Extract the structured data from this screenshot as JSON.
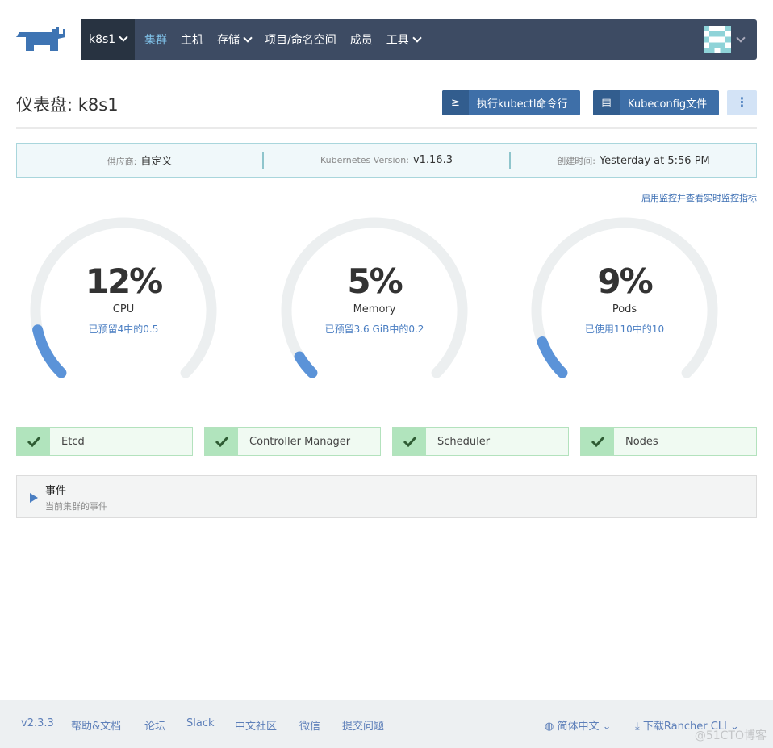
{
  "nav": {
    "cluster": "k8s1",
    "items": [
      {
        "label": "集群",
        "active": true
      },
      {
        "label": "主机"
      },
      {
        "label": "存储",
        "dropdown": true
      },
      {
        "label": "项目/命名空间"
      },
      {
        "label": "成员"
      },
      {
        "label": "工具",
        "dropdown": true
      }
    ]
  },
  "header": {
    "title": "仪表盘: k8s1",
    "kubectl_label": "执行kubectl命令行",
    "kubeconfig_label": "Kubeconfig文件"
  },
  "info": {
    "provider_key": "供应商:",
    "provider": "自定义",
    "version_key": "Kubernetes Version:",
    "version": "v1.16.3",
    "created_key": "创建时间:",
    "created": "Yesterday at 5:56 PM"
  },
  "monitor_link": "启用监控并查看实时监控指标",
  "gauges": [
    {
      "value": "12%",
      "percent": 12,
      "label": "CPU",
      "sub": "已预留4中的0.5"
    },
    {
      "value": "5%",
      "percent": 5,
      "label": "Memory",
      "sub": "已预留3.6 GiB中的0.2"
    },
    {
      "value": "9%",
      "percent": 9,
      "label": "Pods",
      "sub": "已使用110中的10"
    }
  ],
  "components": [
    {
      "name": "Etcd",
      "status": "ok"
    },
    {
      "name": "Controller Manager",
      "status": "ok"
    },
    {
      "name": "Scheduler",
      "status": "ok"
    },
    {
      "name": "Nodes",
      "status": "ok"
    }
  ],
  "events": {
    "title": "事件",
    "subtitle": "当前集群的事件"
  },
  "footer": {
    "version": "v2.3.3",
    "links": [
      "帮助&文档",
      "论坛",
      "Slack",
      "中文社区",
      "微信",
      "提交问题"
    ],
    "language": "简体中文",
    "download": "下载Rancher CLI",
    "watermark": "@51CTO博客"
  },
  "colors": {
    "nav": "#3d4b63",
    "accent": "#3e6fa8",
    "gauge_fill": "#5b93d8",
    "ok": "#b1e4bd"
  }
}
